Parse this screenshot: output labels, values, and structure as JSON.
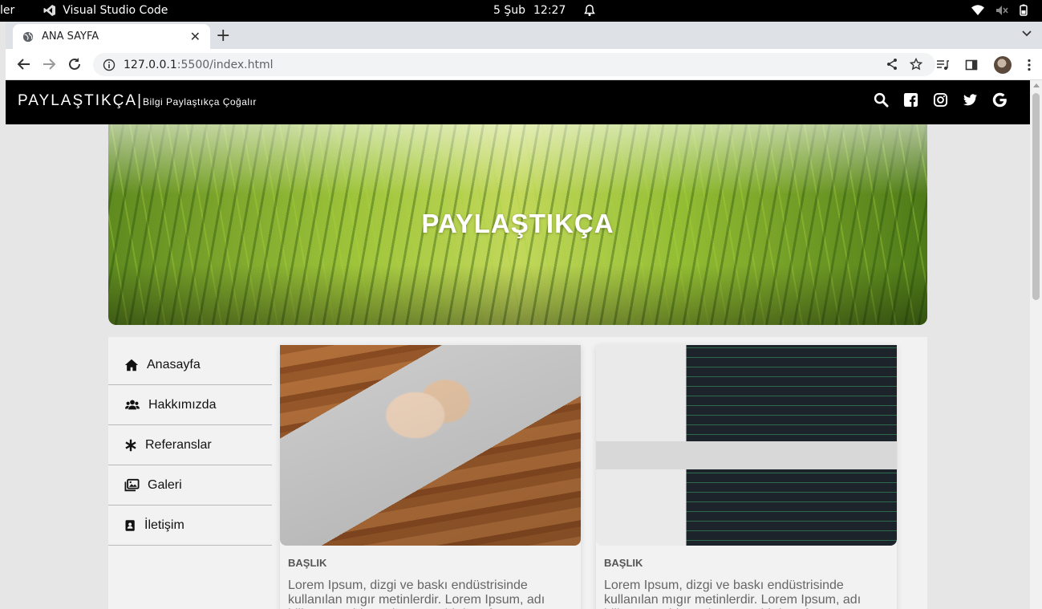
{
  "os": {
    "activities": "ler",
    "app_name": "Visual Studio Code",
    "date": "5 Şub",
    "time": "12:27"
  },
  "browser": {
    "tab_title": "ANA SAYFA",
    "url_host": "127.0.0.1",
    "url_path": ":5500/index.html"
  },
  "site": {
    "brand": "PAYLAŞTIKÇA|",
    "slogan": "Bilgi Paylaştıkça Çoğalır",
    "hero_title": "PAYLAŞTIKÇA",
    "social_icons": [
      "search-icon",
      "facebook-icon",
      "instagram-icon",
      "twitter-icon",
      "google-icon"
    ]
  },
  "sidebar": {
    "items": [
      {
        "label": "Anasayfa",
        "icon": "home-icon"
      },
      {
        "label": "Hakkımızda",
        "icon": "users-icon"
      },
      {
        "label": "Referanslar",
        "icon": "asterisk-icon"
      },
      {
        "label": "Galeri",
        "icon": "images-icon"
      },
      {
        "label": "İletişim",
        "icon": "address-book-icon"
      }
    ]
  },
  "cards": [
    {
      "heading": "BAŞLIK",
      "text": "Lorem Ipsum, dizgi ve baskı endüstrisinde kullanılan mıgır metinlerdir. Lorem Ipsum, adı bilinmeyen bir matbaacının bir hurufat numune kitabı oluşturmak üzere"
    },
    {
      "heading": "BAŞLIK",
      "text": "Lorem Ipsum, dizgi ve baskı endüstrisinde kullanılan mıgır metinlerdir. Lorem Ipsum, adı bilinmeyen bir matbaacının bir hurufat numune kitabı oluşturmak üzere"
    }
  ],
  "colors": {
    "header_bg": "#000000",
    "page_bg": "#e6e6e6",
    "content_bg": "#f2f2f2"
  }
}
